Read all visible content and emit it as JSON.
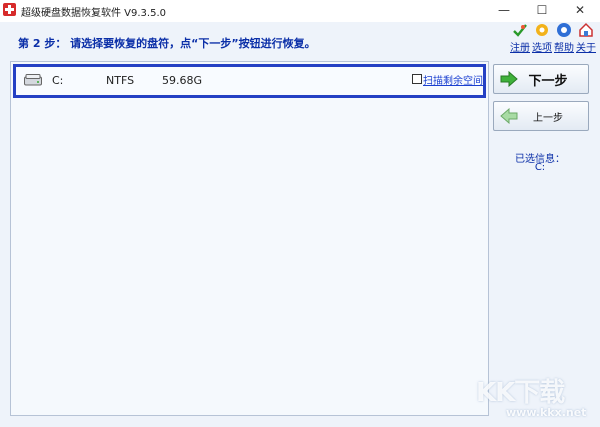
{
  "window": {
    "title": "超级硬盘数据恢复软件 V9.3.5.0",
    "minimize_glyph": "—",
    "maximize_glyph": "☐",
    "close_glyph": "✕"
  },
  "header": {
    "step_text": "第 2 步： 请选择要恢复的盘符，点“下一步”按钮进行恢复。"
  },
  "toolbar": {
    "items": [
      {
        "label": "注册",
        "icon": "register-icon"
      },
      {
        "label": "选项",
        "icon": "options-icon"
      },
      {
        "label": "帮助",
        "icon": "help-icon"
      },
      {
        "label": "关于",
        "icon": "about-icon"
      }
    ]
  },
  "drives": [
    {
      "letter": "C:",
      "filesystem": "NTFS",
      "size": "59.68G",
      "scan_label": "扫描剩余空间",
      "selected": true
    }
  ],
  "buttons": {
    "next": "下一步",
    "prev": "上一步"
  },
  "selection": {
    "title": "已选信息：",
    "value": "C:"
  },
  "watermark": {
    "logo": "KK下载",
    "url": "www.kkx.net"
  },
  "colors": {
    "accent": "#0b2fa8",
    "selection_border": "#2440c4",
    "link": "#1a3fd0",
    "client_bg": "#eef3fa"
  }
}
